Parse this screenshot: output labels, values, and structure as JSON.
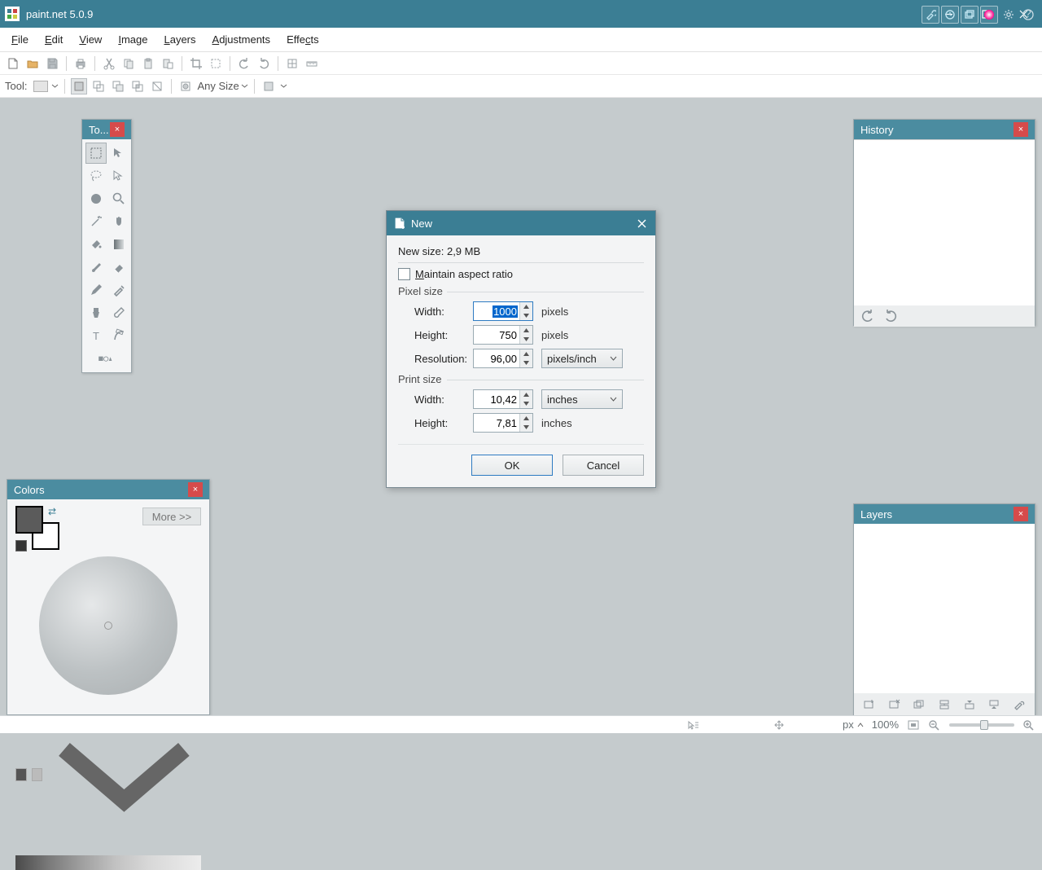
{
  "app": {
    "title": "paint.net 5.0.9"
  },
  "menu": {
    "file": "File",
    "edit": "Edit",
    "view": "View",
    "image": "Image",
    "layers": "Layers",
    "adjustments": "Adjustments",
    "effects": "Effects"
  },
  "toolbar2": {
    "tool_label": "Tool:",
    "anysize": "Any Size"
  },
  "panels": {
    "tools_title": "To...",
    "history_title": "History",
    "layers_title": "Layers",
    "colors_title": "Colors",
    "more_btn": "More >>"
  },
  "dialog": {
    "title": "New",
    "newsize_label": "New size: 2,9 MB",
    "maintain_ratio": "Maintain aspect ratio",
    "pixel_size": "Pixel size",
    "print_size": "Print size",
    "width_label": "Width:",
    "height_label": "Height:",
    "resolution_label": "Resolution:",
    "px_width": "1000",
    "px_height": "750",
    "resolution": "96,00",
    "print_width": "10,42",
    "print_height": "7,81",
    "unit_pixels": "pixels",
    "unit_inches": "inches",
    "unit_ppi": "pixels/inch",
    "ok": "OK",
    "cancel": "Cancel"
  },
  "status": {
    "unit": "px",
    "zoom": "100%"
  }
}
